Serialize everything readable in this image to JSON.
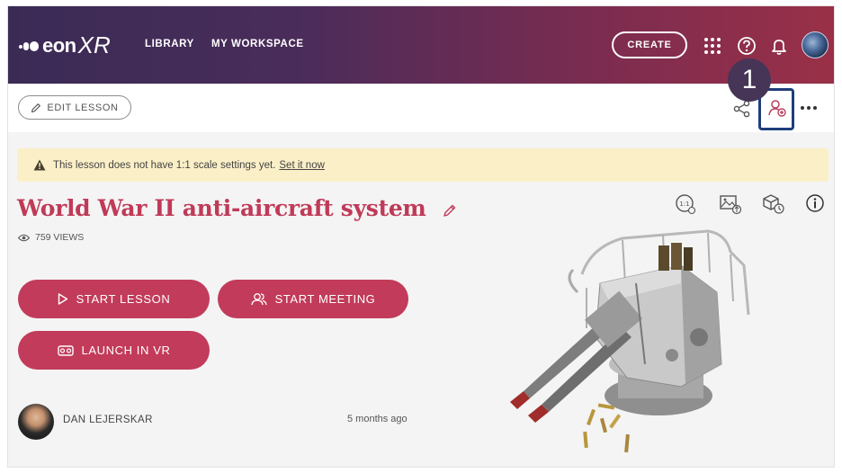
{
  "header": {
    "logo_text": "eon",
    "logo_xr": "XR",
    "nav": [
      "LIBRARY",
      "MY WORKSPACE"
    ],
    "create_label": "CREATE",
    "icons": [
      "apps-grid-icon",
      "help-icon",
      "bell-icon"
    ]
  },
  "toolbar": {
    "edit_label": "EDIT LESSON",
    "badge_number": "1",
    "icons": [
      "share-icon",
      "add-participant-icon",
      "more-icon"
    ]
  },
  "warning": {
    "text": "This lesson does not have 1:1 scale settings yet.",
    "link": "Set it now"
  },
  "lesson": {
    "title": "World War II anti-aircraft system",
    "views": "759 VIEWS",
    "buttons": {
      "start_lesson": "START LESSON",
      "start_meeting": "START MEETING",
      "launch_vr": "LAUNCH IN VR"
    },
    "author": "DAN LEJERSKAR",
    "time": "5 months ago",
    "info_icons": [
      "scale-icon",
      "image-swap-icon",
      "model-history-icon",
      "info-icon"
    ]
  },
  "colors": {
    "accent": "#c23b5a",
    "header_start": "#3a2b55",
    "header_end": "#9a3048",
    "highlight": "#1f3e7a",
    "warning_bg": "#fbefc7"
  }
}
